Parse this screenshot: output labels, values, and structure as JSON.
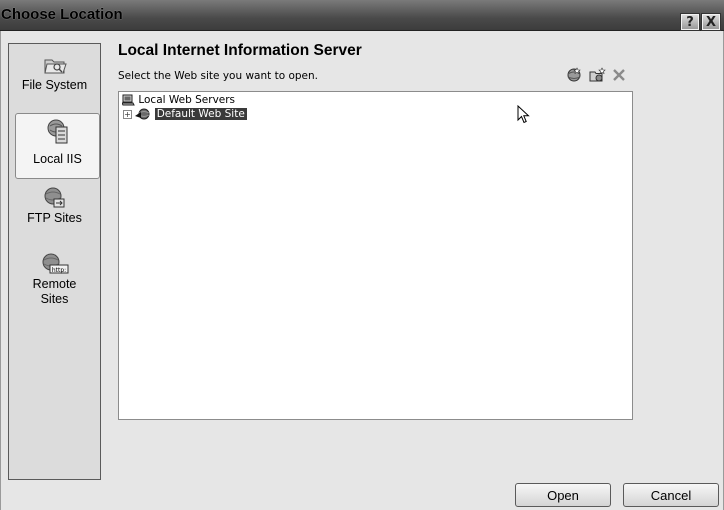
{
  "window": {
    "title": "Choose Location",
    "help_label": "?",
    "close_label": "X"
  },
  "places": [
    {
      "label": "File System",
      "icon": "folder-icon",
      "selected": false
    },
    {
      "label": "Local IIS",
      "icon": "iis-server-icon",
      "selected": true
    },
    {
      "label": "FTP Sites",
      "icon": "ftp-globe-icon",
      "selected": false
    },
    {
      "label": "Remote Sites",
      "icon": "http-globe-icon",
      "selected": false
    }
  ],
  "main": {
    "heading": "Local Internet Information Server",
    "subtext": "Select the Web site you want to open.",
    "toolbar_icons": [
      "new-web-site-icon",
      "new-virtual-directory-icon",
      "delete-icon"
    ]
  },
  "tree": {
    "root_label": "Local Web Servers",
    "root_icon": "server-computer-icon",
    "child_label": "Default Web Site",
    "child_icon": "web-site-icon",
    "expander": "+"
  },
  "buttons": {
    "open": "Open",
    "cancel": "Cancel"
  }
}
